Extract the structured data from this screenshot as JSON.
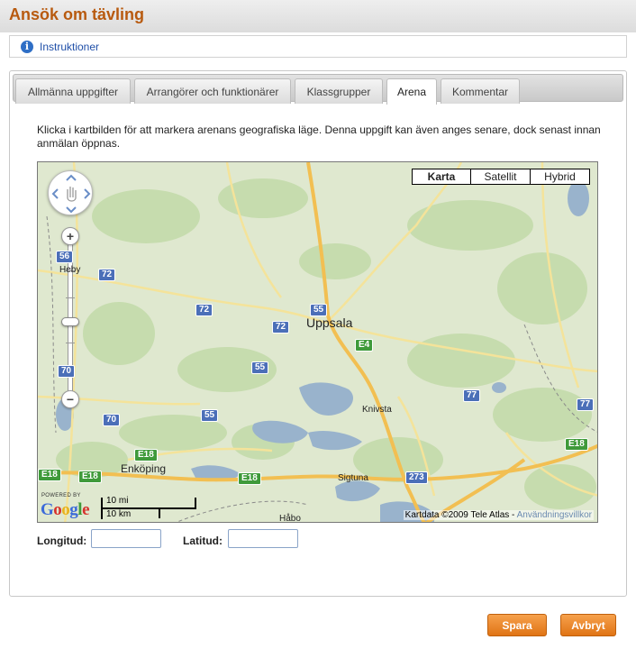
{
  "page": {
    "title": "Ansök om tävling"
  },
  "instructions": {
    "label": "Instruktioner",
    "icon": "info-icon"
  },
  "tabs": [
    {
      "label": "Allmänna uppgifter",
      "active": false
    },
    {
      "label": "Arrangörer och funktionärer",
      "active": false
    },
    {
      "label": "Klassgrupper",
      "active": false
    },
    {
      "label": "Arena",
      "active": true
    },
    {
      "label": "Kommentar",
      "active": false
    }
  ],
  "arena": {
    "intro": "Klicka i kartbilden för att markera arenans geografiska läge. Denna uppgift kan även anges senare, dock senast innan anmälan öppnas.",
    "map": {
      "types": [
        "Karta",
        "Satellit",
        "Hybrid"
      ],
      "selected_type": "Karta",
      "places": {
        "uppsala": "Uppsala",
        "knivsta": "Knivsta",
        "enkoping": "Enköping",
        "sigtuna": "Sigtuna",
        "habo": "Håbo",
        "heby": "Heby"
      },
      "road_numbers": {
        "r56": "56",
        "r72a": "72",
        "r72b": "72",
        "r72c": "72",
        "r70a": "70",
        "r70b": "70",
        "r55a": "55",
        "r55b": "55",
        "r55c": "55",
        "r77a": "77",
        "r77b": "77",
        "r273": "273",
        "e4": "E4",
        "e18a": "E18",
        "e18b": "E18",
        "e18c": "E18",
        "e18d": "E18",
        "e18e": "E18"
      },
      "scale": {
        "miles": "10 mi",
        "km": "10 km"
      },
      "powered_by": "POWERED BY",
      "logo": "Google",
      "attribution": "Kartdata ©2009 Tele Atlas - ",
      "terms_link": "Användningsvillkor",
      "zoom_in": "+",
      "zoom_out": "−",
      "colors": {
        "land": "#dfe8cf",
        "forest": "#c6dcae",
        "water": "#99b3cc",
        "motorway": "#f2bf52",
        "road": "#f4e39a"
      }
    },
    "longitude": {
      "label": "Longitud:",
      "value": ""
    },
    "latitude": {
      "label": "Latitud:",
      "value": ""
    }
  },
  "actions": {
    "save": "Spara",
    "cancel": "Avbryt"
  },
  "colors": {
    "title": "#b85a0f",
    "button": "#e88425",
    "link": "#1f4fa8"
  }
}
